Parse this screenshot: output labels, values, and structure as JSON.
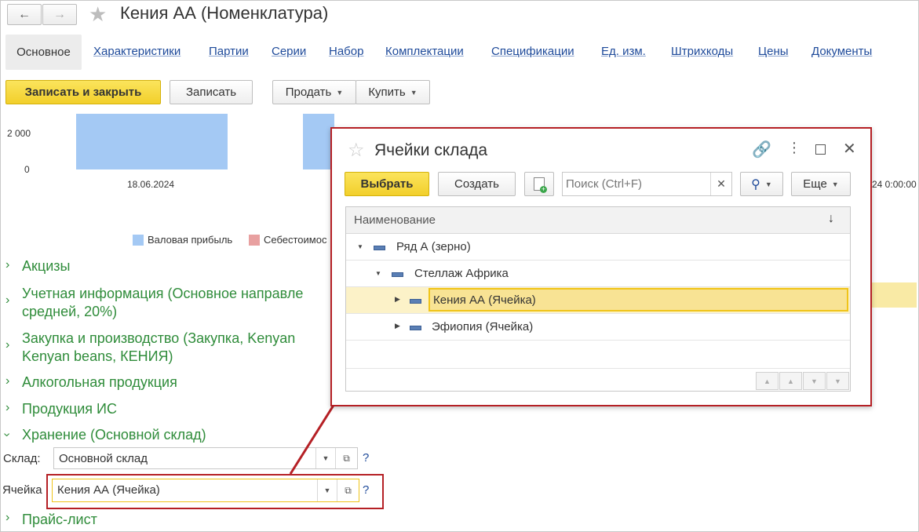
{
  "window": {
    "title": "Кения АА (Номенклатура)"
  },
  "tabs": [
    {
      "label": "Основное",
      "active": true
    },
    {
      "label": "Характеристики"
    },
    {
      "label": "Партии"
    },
    {
      "label": "Серии"
    },
    {
      "label": "Набор"
    },
    {
      "label": "Комплектации"
    },
    {
      "label": "Спецификации"
    },
    {
      "label": "Ед. изм."
    },
    {
      "label": "Штрихкоды"
    },
    {
      "label": "Цены"
    },
    {
      "label": "Документы"
    }
  ],
  "toolbar": {
    "save_close": "Записать и закрыть",
    "save": "Записать",
    "sell": "Продать",
    "buy": "Купить"
  },
  "chart": {
    "y_ticks": [
      "2 000",
      "0"
    ],
    "x_label": "18.06.2024",
    "x_label_right": "24 0:00:00",
    "legend": [
      "Валовая прибыль",
      "Себестоимос"
    ],
    "colors": {
      "gross": "#a4c9f4",
      "cost": "#e8a0a0"
    }
  },
  "sections": [
    {
      "label": "Акцизы"
    },
    {
      "label": "Учетная информация (Основное направле",
      "line2": "средней, 20%)"
    },
    {
      "label": "Закупка и производство (Закупка, Kenyan",
      "line2": "Kenyan beans, КЕНИЯ)"
    },
    {
      "label": "Алкогольная продукция"
    },
    {
      "label": "Продукция ИС"
    },
    {
      "label": "Хранение (Основной склад)",
      "expanded": true
    },
    {
      "label": "Прайс-лист"
    }
  ],
  "storage": {
    "warehouse_label": "Склад:",
    "warehouse_value": "Основной склад",
    "cell_label": "Ячейка",
    "cell_value": "Кения АА (Ячейка)",
    "help": "?"
  },
  "dialog": {
    "title": "Ячейки склада",
    "select": "Выбрать",
    "create": "Создать",
    "search_placeholder": "Поиск (Ctrl+F)",
    "more": "Еще",
    "column": "Наименование",
    "sort_icon": "↓",
    "rows": [
      {
        "label": "Ряд А (зерно)"
      },
      {
        "label": "Стеллаж Африка"
      },
      {
        "label": "Кения АА (Ячейка)",
        "selected": true
      },
      {
        "label": "Эфиопия (Ячейка)"
      }
    ]
  },
  "colors": {
    "accent_yellow": "#f2cf2b",
    "link": "#1e4a9a",
    "section_green": "#2f8c3a",
    "highlight_red": "#b52025"
  }
}
